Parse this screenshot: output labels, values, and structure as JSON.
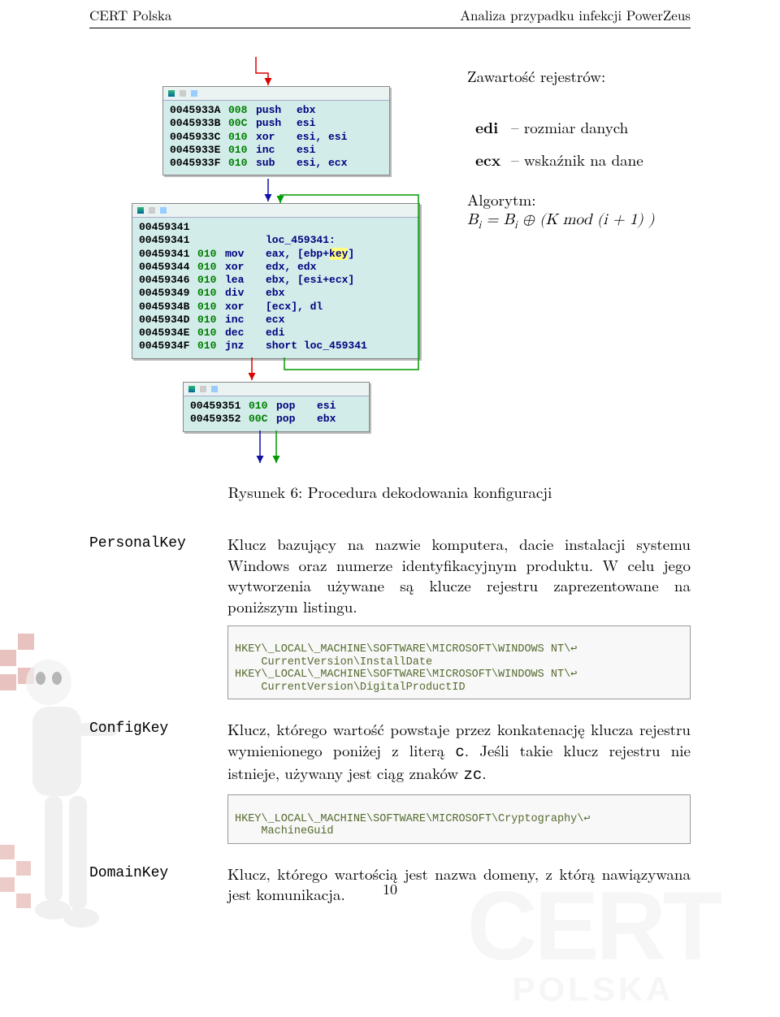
{
  "header": {
    "left": "CERT Polska",
    "right": "Analiza przypadku infekcji PowerZeus"
  },
  "side": {
    "heading": "Zawartość rejestrów:",
    "regs": [
      {
        "name": "edi",
        "desc": "– rozmiar danych"
      },
      {
        "name": "ecx",
        "desc": "– wskaźnik na dane"
      }
    ],
    "alg_label": "Algorytm:",
    "alg_math_html": "<i>B<sub>i</sub></i> = <i>B<sub>i</sub></i> ⊕ (<i>K</i> mod (<i>i</i> + 1) )"
  },
  "figure_caption": "Rysunek 6: Procedura dekodowania konfiguracji",
  "asm": {
    "box1": [
      {
        "addr": "0045933A",
        "sz": "008",
        "mn": "push",
        "ops": "ebx"
      },
      {
        "addr": "0045933B",
        "sz": "00C",
        "mn": "push",
        "ops": "esi"
      },
      {
        "addr": "0045933C",
        "sz": "010",
        "mn": "xor",
        "ops": "esi, esi"
      },
      {
        "addr": "0045933E",
        "sz": "010",
        "mn": "inc",
        "ops": "esi"
      },
      {
        "addr": "0045933F",
        "sz": "010",
        "mn": "sub",
        "ops": "esi, ecx"
      }
    ],
    "box2_label": "loc_459341:",
    "box2": [
      {
        "addr": "00459341",
        "sz": "",
        "mn": "",
        "ops": ""
      },
      {
        "addr": "00459341",
        "sz": "010",
        "mn": "mov",
        "ops_html": "eax, [ebp+<span class='highlight'>key</span>]"
      },
      {
        "addr": "00459344",
        "sz": "010",
        "mn": "xor",
        "ops": "edx, edx"
      },
      {
        "addr": "00459346",
        "sz": "010",
        "mn": "lea",
        "ops": "ebx, [esi+ecx]"
      },
      {
        "addr": "00459349",
        "sz": "010",
        "mn": "div",
        "ops": "ebx"
      },
      {
        "addr": "0045934B",
        "sz": "010",
        "mn": "xor",
        "ops": "[ecx], dl"
      },
      {
        "addr": "0045934D",
        "sz": "010",
        "mn": "inc",
        "ops": "ecx"
      },
      {
        "addr": "0045934E",
        "sz": "010",
        "mn": "dec",
        "ops": "edi"
      },
      {
        "addr": "0045934F",
        "sz": "010",
        "mn": "jnz",
        "ops": "short loc_459341"
      }
    ],
    "box3": [
      {
        "addr": "00459351",
        "sz": "010",
        "mn": "pop",
        "ops": "esi"
      },
      {
        "addr": "00459352",
        "sz": "00C",
        "mn": "pop",
        "ops": "ebx"
      }
    ]
  },
  "defs": [
    {
      "term": "PersonalKey",
      "body": "Klucz bazujący na nazwie komputera, dacie instalacji systemu Windows oraz numerze identyfikacyjnym produktu. W celu jego wytworzenia używane są klucze rejestru zaprezentowane na poniższym listingu.",
      "code": [
        "HKEY\\_LOCAL\\_MACHINE\\SOFTWARE\\MICROSOFT\\WINDOWS NT\\↩",
        "    CurrentVersion\\InstallDate",
        "HKEY\\_LOCAL\\_MACHINE\\SOFTWARE\\MICROSOFT\\WINDOWS NT\\↩",
        "    CurrentVersion\\DigitalProductID"
      ]
    },
    {
      "term": "ConfigKey",
      "body_html": "Klucz, którego wartość powstaje przez konkatenację klucza rejestru wymienionego poniżej z literą <span class='tt'>c</span>. Jeśli takie klucz rejestru nie istnieje, używany jest ciąg znaków <span class='tt'>zc</span>.",
      "code": [
        "HKEY\\_LOCAL\\_MACHINE\\SOFTWARE\\MICROSOFT\\Cryptography\\↩",
        "    MachineGuid"
      ]
    },
    {
      "term": "DomainKey",
      "body": "Klucz, którego wartością jest nazwa domeny, z którą nawiązywana jest komunikacja."
    }
  ],
  "page_number": "10",
  "watermark": {
    "brand": "CERT",
    "sub": "POLSKA"
  }
}
